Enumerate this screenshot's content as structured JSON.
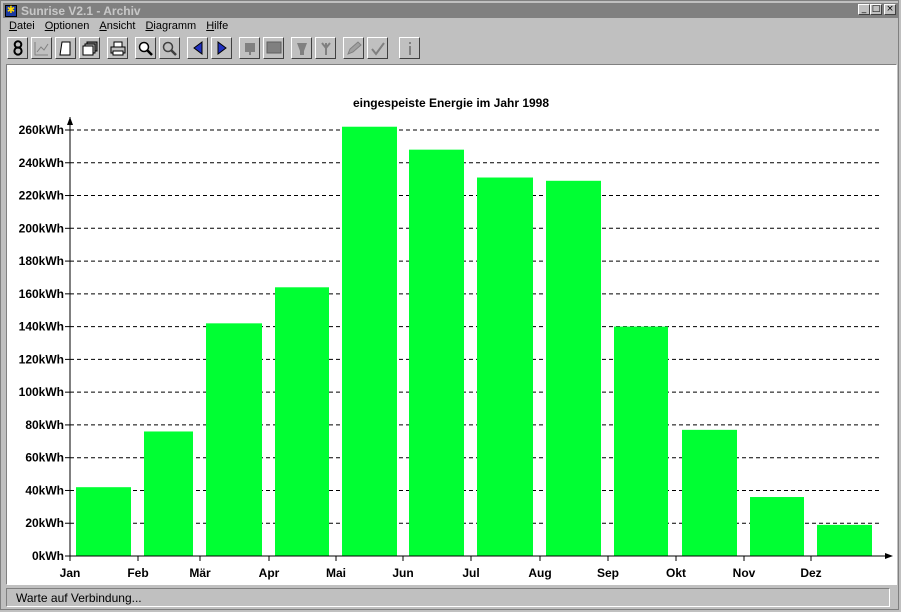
{
  "window": {
    "title": "Sunrise V2.1 - Archiv",
    "buttons": {
      "minimize": "_",
      "maximize": "□",
      "close": "×"
    }
  },
  "menu": [
    {
      "label": "Datei",
      "accel_index": 0
    },
    {
      "label": "Optionen",
      "accel_index": 0
    },
    {
      "label": "Ansicht",
      "accel_index": 0
    },
    {
      "label": "Diagramm",
      "accel_index": 0
    },
    {
      "label": "Hilfe",
      "accel_index": 0
    }
  ],
  "toolbar": {
    "buttons": [
      {
        "name": "day-view-button",
        "icon": "figure-eight-icon"
      },
      {
        "name": "chart-view-button",
        "icon": "line-chart-icon"
      },
      {
        "name": "page-button",
        "icon": "page-icon"
      },
      {
        "name": "archive-button",
        "icon": "stacked-pages-icon"
      },
      {
        "name": "print-button",
        "icon": "printer-icon"
      },
      {
        "name": "zoom-in-button",
        "icon": "zoom-in-icon"
      },
      {
        "name": "zoom-out-button",
        "icon": "zoom-out-icon"
      },
      {
        "name": "previous-button",
        "icon": "arrow-left-icon"
      },
      {
        "name": "next-button",
        "icon": "arrow-right-icon"
      },
      {
        "name": "connect-button",
        "icon": "plug-icon"
      },
      {
        "name": "display-button",
        "icon": "monitor-icon"
      },
      {
        "name": "inverter-button",
        "icon": "inverter-icon"
      },
      {
        "name": "sensor-button",
        "icon": "sensor-icon"
      },
      {
        "name": "edit-button",
        "icon": "pencil-icon"
      },
      {
        "name": "check-button",
        "icon": "checkmark-icon"
      },
      {
        "name": "info-button",
        "icon": "info-icon"
      }
    ]
  },
  "chart_data": {
    "type": "bar",
    "title": "eingespeiste Energie im Jahr 1998",
    "categories": [
      "Jan",
      "Feb",
      "Mär",
      "Apr",
      "Mai",
      "Jun",
      "Jul",
      "Aug",
      "Sep",
      "Okt",
      "Nov",
      "Dez"
    ],
    "values": [
      42,
      76,
      142,
      164,
      262,
      248,
      231,
      229,
      140,
      77,
      36,
      19
    ],
    "unit": "kWh",
    "ylim": [
      0,
      260
    ],
    "yticks": [
      "0kWh",
      "20kWh",
      "40kWh",
      "60kWh",
      "80kWh",
      "100kWh",
      "120kWh",
      "140kWh",
      "160kWh",
      "180kWh",
      "200kWh",
      "220kWh",
      "240kWh",
      "260kWh"
    ],
    "grid": "horizontal-dashed",
    "bar_color": "#00ff33",
    "xlabel": "",
    "ylabel": ""
  },
  "status": {
    "text": "Warte auf Verbindung..."
  }
}
